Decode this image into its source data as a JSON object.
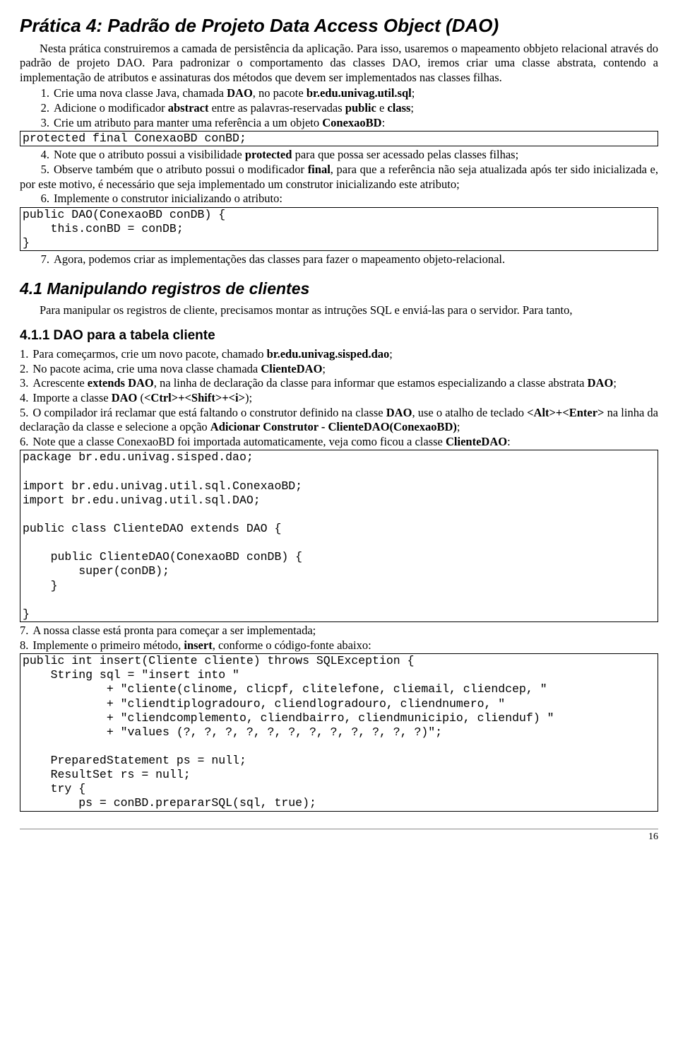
{
  "h1": "Prática 4: Padrão de Projeto Data Access Object (DAO)",
  "intro1": "Nesta prática construiremos a camada de persistência da aplicação. Para isso, usaremos o mapeamento obbjeto relacional através do padrão de projeto DAO. Para padronizar o comportamento das classes DAO, iremos criar uma classe abstrata, contendo a implementação de atributos e assinaturas dos métodos que devem ser implementados nas classes filhas.",
  "steps1": {
    "n1": "1.",
    "t1a": "Crie uma nova classe Java, chamada ",
    "t1b": "DAO",
    "t1c": ", no pacote ",
    "t1d": "br.edu.univag.util.sql",
    "t1e": ";",
    "n2": "2.",
    "t2a": "Adicione o modificador ",
    "t2b": "abstract",
    "t2c": " entre as palavras-reservadas ",
    "t2d": "public",
    "t2e": " e ",
    "t2f": "class",
    "t2g": ";",
    "n3": "3.",
    "t3a": "Crie um atributo para manter uma referência a um objeto ",
    "t3b": "ConexaoBD",
    "t3c": ":"
  },
  "code1": "protected final ConexaoBD conBD;",
  "steps2": {
    "n4": "4.",
    "t4a": "Note que o atributo possui a visibilidade ",
    "t4b": "protected",
    "t4c": " para que possa ser acessado pelas classes filhas;",
    "n5": "5.",
    "t5a": "Observe também que o atributo possui o modificador ",
    "t5b": "final",
    "t5c": ", para que a referência não seja atualizada após ter sido inicializada e, por este motivo, é necessário que seja implementado um construtor inicializando este atributo;",
    "n6": "6.",
    "t6": "Implemente o construtor inicializando o atributo:"
  },
  "code2": "public DAO(ConexaoBD conDB) {\n    this.conBD = conDB;\n}",
  "steps3": {
    "n7": "7.",
    "t7": "Agora, podemos criar as implementações das classes para fazer o mapeamento objeto-relacional."
  },
  "h2": "4.1 Manipulando registros de clientes",
  "intro2": "Para manipular os registros de cliente, precisamos montar as intruções SQL e enviá-las para o servidor. Para tanto,",
  "h3": "4.1.1 DAO para a tabela cliente",
  "stepsB": {
    "n1": "1.",
    "t1a": "Para começarmos, crie um novo pacote, chamado ",
    "t1b": "br.edu.univag.sisped.dao",
    "t1c": ";",
    "n2": "2.",
    "t2a": "No pacote acima, crie uma nova classe chamada ",
    "t2b": "ClienteDAO",
    "t2c": ";",
    "n3": "3.",
    "t3a": "Acrescente ",
    "t3b": "extends DAO",
    "t3c": ", na linha de declaração da classe para informar que estamos especializando a classe abstrata ",
    "t3d": "DAO",
    "t3e": ";",
    "n4": "4.",
    "t4a": "Importe a classe ",
    "t4b": "DAO",
    "t4c": " (",
    "t4d": "<Ctrl>+<Shift>+<i>",
    "t4e": ");",
    "n5": "5.",
    "t5a": "O compilador irá reclamar que está faltando o construtor definido na classe ",
    "t5b": "DAO",
    "t5c": ", use o atalho de teclado ",
    "t5d": "<Alt>+<Enter>",
    "t5e": " na linha da declaração da classe e selecione a opção ",
    "t5f": "Adicionar Construtor - ClienteDAO(ConexaoBD)",
    "t5g": ";",
    "n6": "6.",
    "t6a": "Note que a classe ConexaoBD foi importada automaticamente, veja como ficou a classe ",
    "t6b": "ClienteDAO",
    "t6c": ":"
  },
  "code3": "package br.edu.univag.sisped.dao;\n\nimport br.edu.univag.util.sql.ConexaoBD;\nimport br.edu.univag.util.sql.DAO;\n\npublic class ClienteDAO extends DAO {\n\n    public ClienteDAO(ConexaoBD conDB) {\n        super(conDB);\n    }\n\n}",
  "stepsC": {
    "n7": "7.",
    "t7": "A nossa classe está pronta para começar a ser implementada;",
    "n8": "8.",
    "t8a": "Implemente o primeiro método, ",
    "t8b": "insert",
    "t8c": ", conforme o código-fonte abaixo:"
  },
  "code4": "public int insert(Cliente cliente) throws SQLException {\n    String sql = \"insert into \"\n            + \"cliente(clinome, clicpf, clitelefone, cliemail, cliendcep, \"\n            + \"cliendtiplogradouro, cliendlogradouro, cliendnumero, \"\n            + \"cliendcomplemento, cliendbairro, cliendmunicipio, clienduf) \"\n            + \"values (?, ?, ?, ?, ?, ?, ?, ?, ?, ?, ?, ?)\";\n\n    PreparedStatement ps = null;\n    ResultSet rs = null;\n    try {\n        ps = conBD.prepararSQL(sql, true);",
  "pagenum": "16"
}
